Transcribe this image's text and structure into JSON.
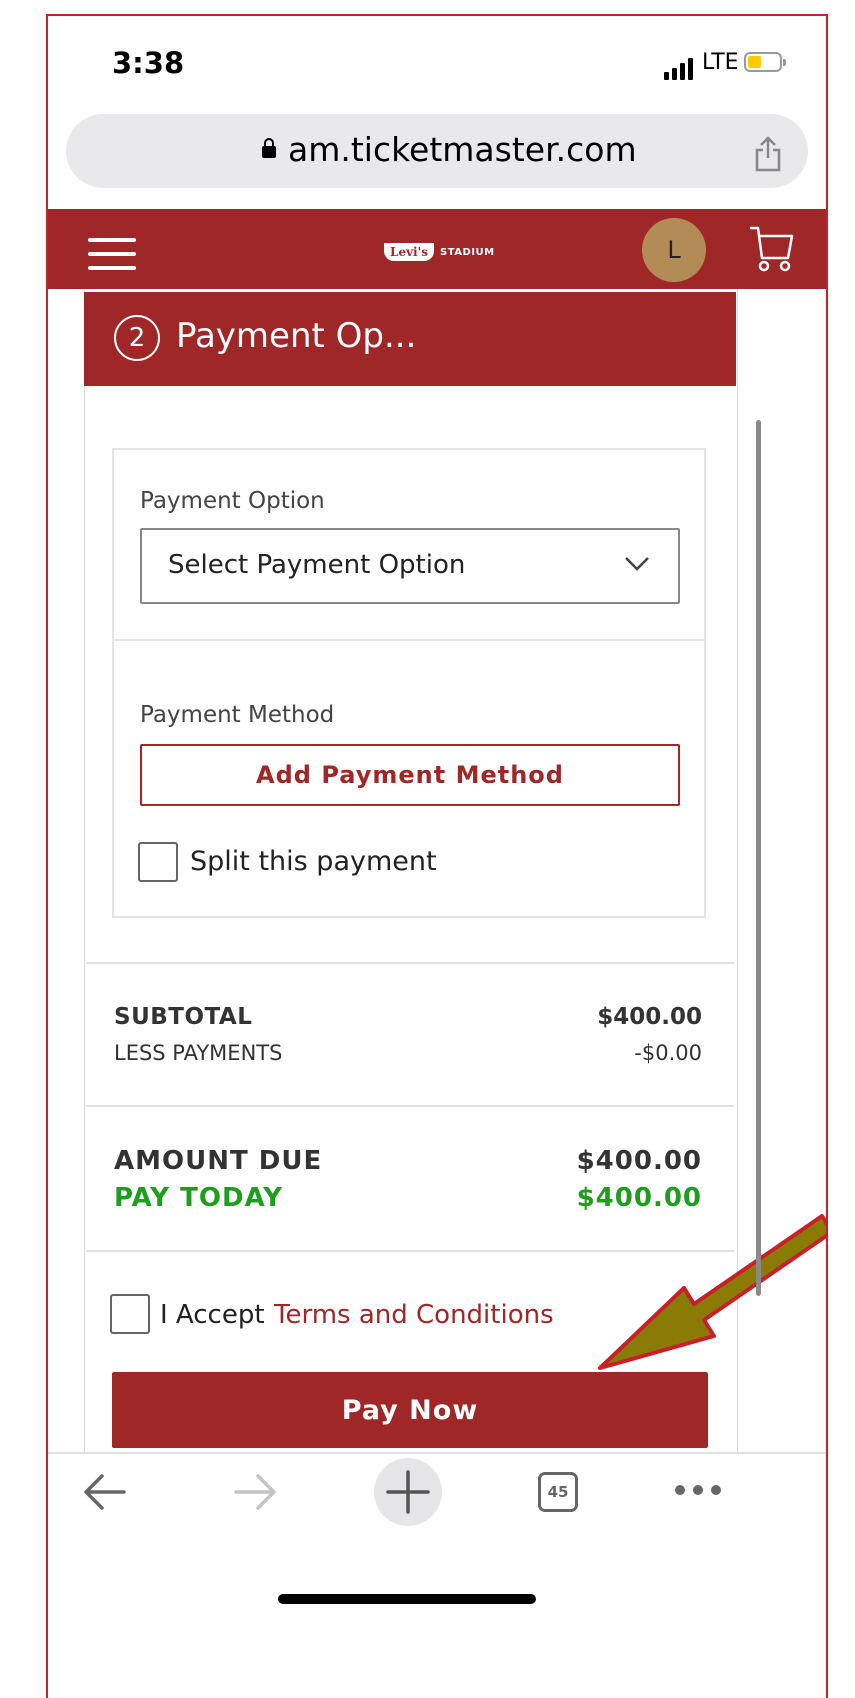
{
  "status_bar": {
    "time": "3:38",
    "network": "LTE",
    "battery_color": "#ffcc00"
  },
  "browser": {
    "url": "am.ticketmaster.com",
    "tabs_count": "45"
  },
  "header": {
    "logo_brand": "Levi's",
    "logo_venue": "STADIUM",
    "avatar_initial": "L",
    "color": "#a02728"
  },
  "step": {
    "number": "2",
    "title": "Payment Op..."
  },
  "payment": {
    "option_label": "Payment Option",
    "option_selected": "Select Payment Option",
    "method_label": "Payment Method",
    "add_method_label": "Add Payment Method",
    "split_label": "Split this payment"
  },
  "summary": {
    "subtotal_label": "SUBTOTAL",
    "subtotal_value": "$400.00",
    "less_label": "LESS PAYMENTS",
    "less_value": "-$0.00",
    "due_label": "AMOUNT DUE",
    "due_value": "$400.00",
    "pay_today_label": "PAY TODAY",
    "pay_today_value": "$400.00"
  },
  "terms": {
    "prefix": "I Accept",
    "link": "Terms and Conditions"
  },
  "pay_button": "Pay Now"
}
